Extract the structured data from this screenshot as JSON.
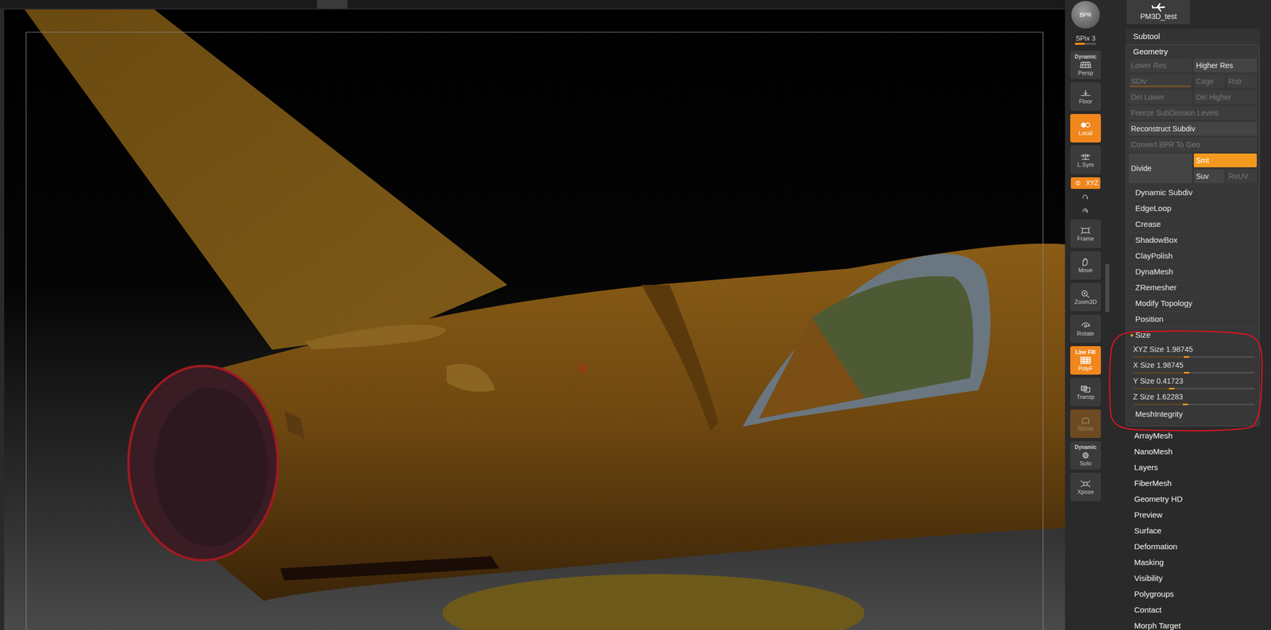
{
  "shelf": [
    {
      "kind": "round",
      "label": "BPR",
      "active": false,
      "disabled": false
    },
    {
      "kind": "slider",
      "label": "SPix 3",
      "level": 0.45
    },
    {
      "kind": "button",
      "top": "Dynamic",
      "label": "Persp",
      "active": false,
      "disabled": false
    },
    {
      "kind": "button",
      "label": "Floor",
      "active": false,
      "disabled": false
    },
    {
      "kind": "button",
      "label": "Local",
      "active": true,
      "disabled": false
    },
    {
      "kind": "button",
      "label": "L.Sym",
      "active": false,
      "disabled": false
    },
    {
      "kind": "small",
      "label": "XYZ",
      "active": true,
      "disabled": false
    },
    {
      "kind": "icon",
      "active": false,
      "disabled": false
    },
    {
      "kind": "icon",
      "active": false,
      "disabled": false
    },
    {
      "kind": "button",
      "label": "Frame",
      "active": false,
      "disabled": false
    },
    {
      "kind": "button",
      "label": "Move",
      "active": false,
      "disabled": false
    },
    {
      "kind": "button",
      "label": "Zoom3D",
      "active": false,
      "disabled": false
    },
    {
      "kind": "button",
      "label": "Rotate",
      "active": false,
      "disabled": false
    },
    {
      "kind": "button",
      "top": "Line Fill",
      "label": "PolyF",
      "active": true,
      "disabled": false
    },
    {
      "kind": "button",
      "label": "Transp",
      "active": false,
      "disabled": false
    },
    {
      "kind": "button",
      "label": "Ghost",
      "active": true,
      "disabled": true
    },
    {
      "kind": "button",
      "top": "Dynamic",
      "label": "Solo",
      "active": false,
      "disabled": false
    },
    {
      "kind": "button",
      "label": "Xpose",
      "active": false,
      "disabled": false
    }
  ],
  "tool": {
    "name": "PM3D_test"
  },
  "subtool": "Subtool",
  "geometry": {
    "title": "Geometry",
    "expanded": true,
    "rows": [
      [
        {
          "kind": "button",
          "label": "Lower Res",
          "disabled": true
        },
        {
          "kind": "button",
          "label": "Higher Res",
          "disabled": false
        }
      ],
      [
        {
          "kind": "slider",
          "label": "SDiv",
          "disabled": true,
          "level": 1
        },
        {
          "kind": "button",
          "label": "Cage",
          "disabled": true
        },
        {
          "kind": "button",
          "label": "Rstr",
          "disabled": true
        }
      ],
      [
        {
          "kind": "button",
          "label": "Del Lower",
          "disabled": true
        },
        {
          "kind": "button",
          "label": "Del Higher",
          "disabled": true
        }
      ],
      [
        {
          "kind": "button",
          "label": "Freeze SubDivision Levels",
          "disabled": true
        }
      ],
      [
        {
          "kind": "button",
          "label": "Reconstruct Subdiv",
          "disabled": false
        }
      ],
      [
        {
          "kind": "button",
          "label": "Convert BPR To Geo",
          "disabled": true
        }
      ]
    ],
    "divide": {
      "label": "Divide",
      "options": [
        {
          "label": "Smt",
          "selected": true,
          "disabled": false
        },
        {
          "label": "Suv",
          "selected": false,
          "disabled": false
        },
        {
          "label": "ReUV",
          "selected": false,
          "disabled": true
        }
      ]
    },
    "items": [
      {
        "label": "Dynamic Subdiv",
        "expanded": false
      },
      {
        "label": "EdgeLoop",
        "expanded": false
      },
      {
        "label": "Crease",
        "expanded": false
      },
      {
        "label": "ShadowBox",
        "expanded": false
      },
      {
        "label": "ClayPolish",
        "expanded": false
      },
      {
        "label": "DynaMesh",
        "expanded": false
      },
      {
        "label": "ZRemesher",
        "expanded": false
      },
      {
        "label": "Modify Topology",
        "expanded": false
      },
      {
        "label": "Position",
        "expanded": false
      },
      {
        "label": "Size",
        "expanded": true,
        "sliders": [
          {
            "label": "XYZ Size",
            "value": "1.98745",
            "level": 0.46
          },
          {
            "label": "X Size",
            "value": "1.98745",
            "level": 0.46
          },
          {
            "label": "Y Size",
            "value": "0.41723",
            "level": 0.34
          },
          {
            "label": "Z Size",
            "value": "1.62283",
            "level": 0.45
          }
        ]
      },
      {
        "label": "MeshIntegrity",
        "expanded": false
      }
    ]
  },
  "menus": [
    "ArrayMesh",
    "NanoMesh",
    "Layers",
    "FiberMesh",
    "Geometry HD",
    "Preview",
    "Surface",
    "Deformation",
    "Masking",
    "Visibility",
    "Polygroups",
    "Contact",
    "Morph Target"
  ]
}
